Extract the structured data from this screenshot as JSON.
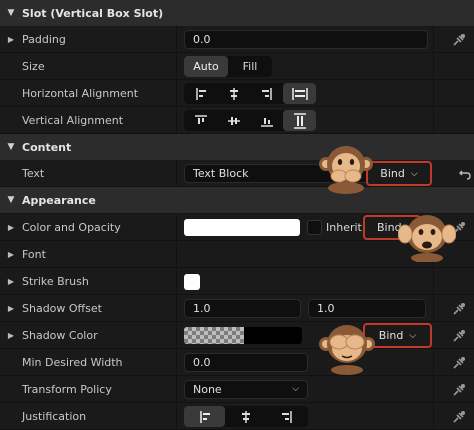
{
  "sections": {
    "slot": "Slot (Vertical Box Slot)",
    "content": "Content",
    "appearance": "Appearance"
  },
  "rows": {
    "padding": {
      "label": "Padding",
      "value": "0.0"
    },
    "size": {
      "label": "Size",
      "options": [
        "Auto",
        "Fill"
      ],
      "selected": "Auto"
    },
    "h_align": {
      "label": "Horizontal Alignment"
    },
    "v_align": {
      "label": "Vertical Alignment"
    },
    "text": {
      "label": "Text",
      "value": "Text Block",
      "bind": "Bind"
    },
    "color": {
      "label": "Color and Opacity",
      "inherit": "Inherit",
      "bind": "Bind"
    },
    "font": {
      "label": "Font"
    },
    "strike": {
      "label": "Strike Brush"
    },
    "shadow_offset": {
      "label": "Shadow Offset",
      "x": "1.0",
      "y": "1.0"
    },
    "shadow_color": {
      "label": "Shadow Color",
      "bind": "Bind"
    },
    "min_width": {
      "label": "Min Desired Width",
      "value": "0.0"
    },
    "transform": {
      "label": "Transform Policy",
      "value": "None"
    },
    "justification": {
      "label": "Justification"
    }
  },
  "colors": {
    "highlight": "#c0392b",
    "background": "#1a1a1a",
    "header": "#2c2c2c"
  }
}
